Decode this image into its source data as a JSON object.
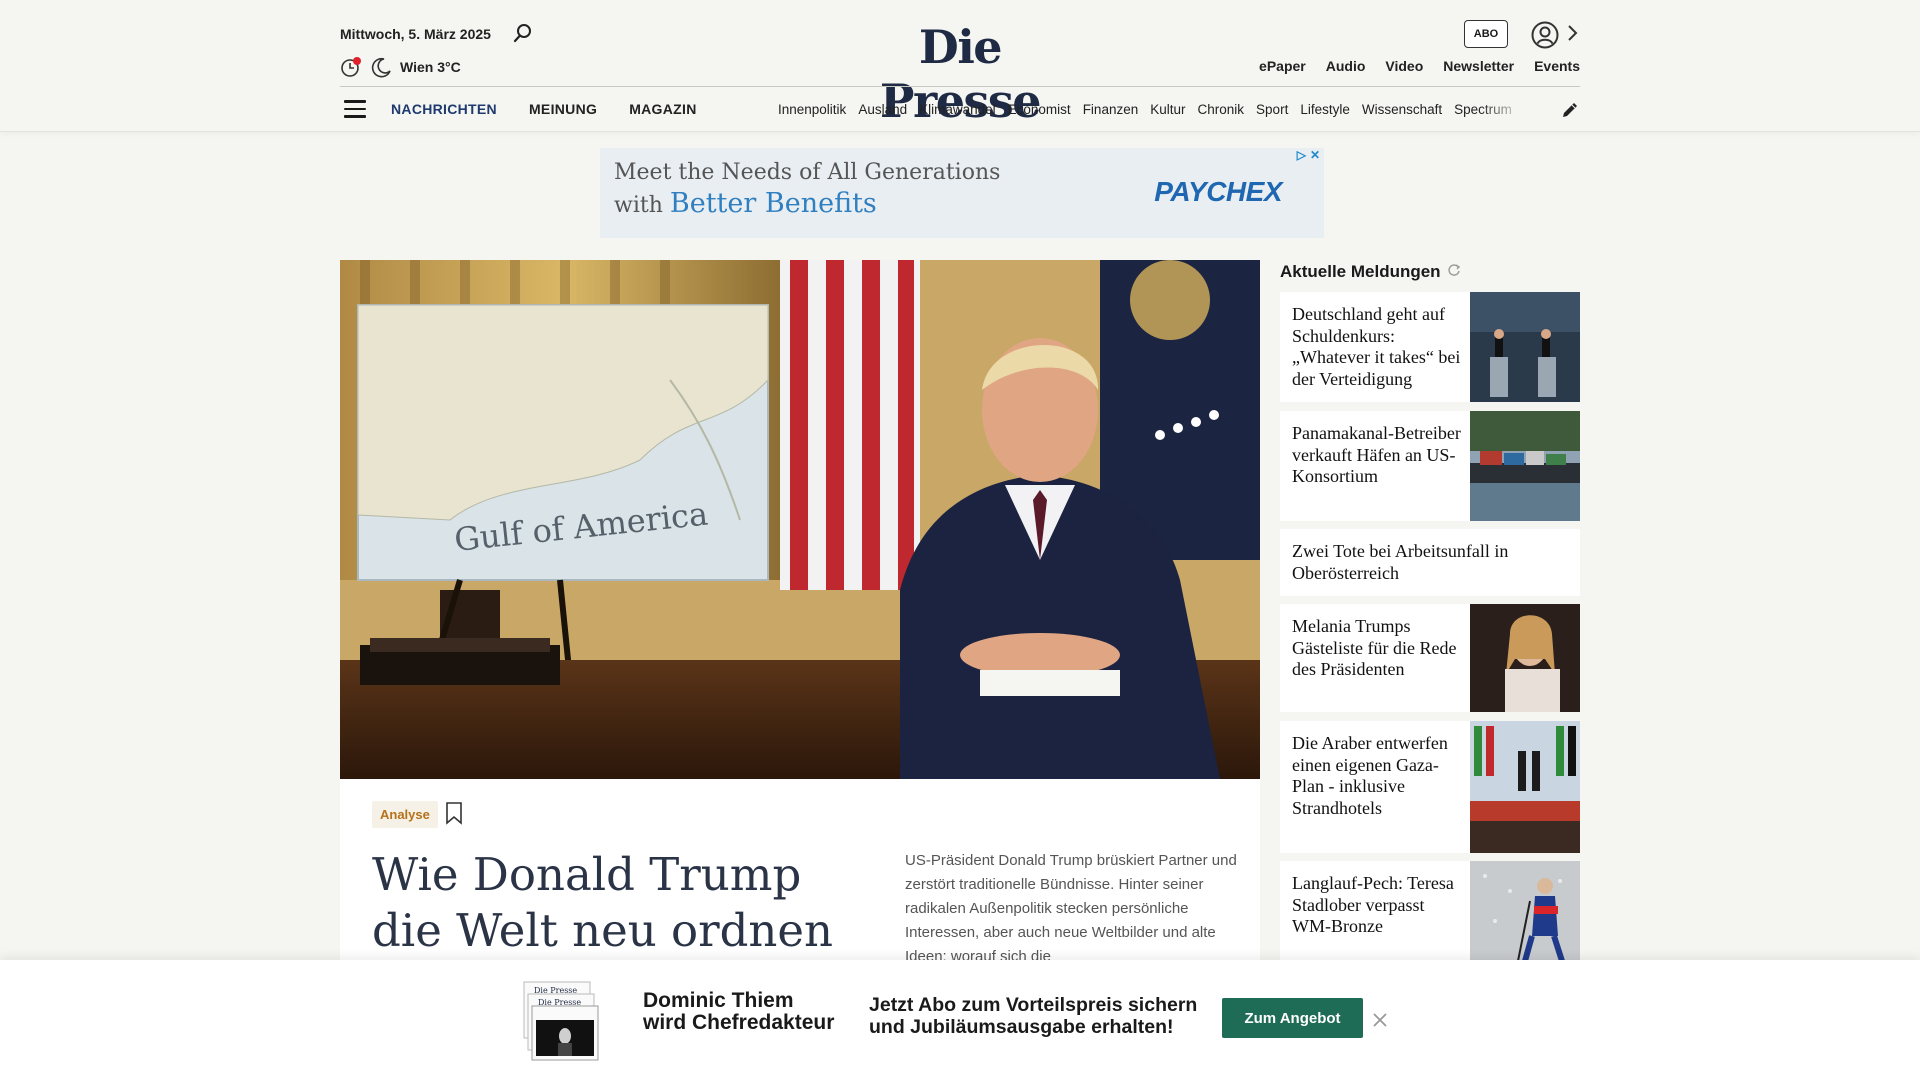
{
  "header": {
    "date": "Mittwoch, 5. März 2025",
    "weather": "Wien 3°C",
    "logo": "Die Presse",
    "abo_label": "ABO",
    "top_links": [
      "ePaper",
      "Audio",
      "Video",
      "Newsletter",
      "Events"
    ],
    "main_nav": [
      "NACHRICHTEN",
      "MEINUNG",
      "MAGAZIN"
    ],
    "sub_nav": [
      "Innenpolitik",
      "Ausland",
      "Klimawandel",
      "Economist",
      "Finanzen",
      "Kultur",
      "Chronik",
      "Sport",
      "Lifestyle",
      "Wissenschaft",
      "Spectrum"
    ]
  },
  "ad": {
    "line1": "Meet the Needs of All Generations",
    "line2_prefix": "with",
    "line2_highlight": "Better Benefits",
    "brand": "PAYCHEX"
  },
  "hero": {
    "image_map_label": "Gulf of America",
    "tag": "Analyse",
    "headline": "Wie Donald Trump die Welt neu ordnen will",
    "teaser": "US-Präsident Donald Trump brüskiert Partner und zerstört traditionelle Bündnisse. Hinter seiner radikalen Außenpolitik stecken persönliche Interessen, aber auch neue Weltbilder und alte Ideen; worauf sich die"
  },
  "sidebar": {
    "title": "Aktuelle Meldungen",
    "items": [
      {
        "title": "Deutschland geht auf Schuldenkurs: „Whatever it takes“ bei der Verteidigung",
        "thumb": "podium-press-conference"
      },
      {
        "title": "Panamakanal-Betreiber verkauft Häfen an US-Konsortium",
        "thumb": "container-ship"
      },
      {
        "title": "Zwei Tote bei Arbeitsunfall in Oberösterreich",
        "thumb": ""
      },
      {
        "title": "Melania Trumps Gästeliste für die Rede des Präsidenten",
        "thumb": "melania-portrait"
      },
      {
        "title": "Die Araber entwerfen einen eigenen Gaza-Plan - inklusive Strandhotels",
        "thumb": "arab-summit"
      },
      {
        "title": "Langlauf-Pech: Teresa Stadlober verpasst WM-Bronze",
        "thumb": "cross-country-skier"
      }
    ]
  },
  "promo": {
    "name_line1": "Dominic Thiem",
    "name_line2": "wird Chefredakteur",
    "offer_line1": "Jetzt Abo zum Vorteilspreis sichern",
    "offer_line2": "und Jubiläumsausgabe erhalten!",
    "button": "Zum Angebot",
    "paper_label": "Die Presse"
  },
  "colors": {
    "brand_navy": "#1f2a44",
    "nav_active": "#1e3a6e",
    "tag_text": "#b5711c",
    "cta_green": "#1e6b56"
  }
}
